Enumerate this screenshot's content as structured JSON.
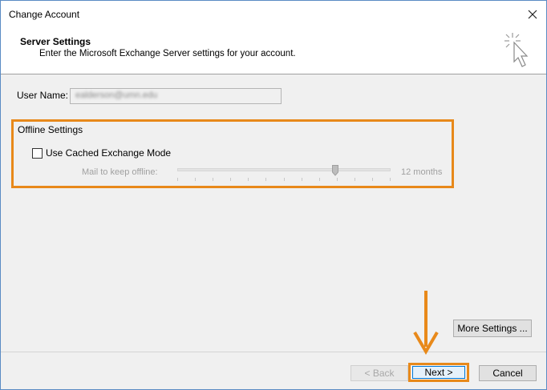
{
  "window": {
    "title": "Change Account"
  },
  "header": {
    "title": "Server Settings",
    "subtitle": "Enter the Microsoft Exchange Server settings for your account."
  },
  "form": {
    "username_label": "User Name:",
    "username_value": "ealderson@umn.edu"
  },
  "offline": {
    "group_label": "Offline Settings",
    "cached_mode_label": "Use Cached Exchange Mode",
    "cached_mode_checked": false,
    "keep_offline_label": "Mail to keep offline:",
    "keep_offline_value": "12 months",
    "slider_fraction": 0.74
  },
  "buttons": {
    "more_settings": "More Settings ...",
    "back": "< Back",
    "next": "Next >",
    "cancel": "Cancel"
  },
  "colors": {
    "highlight": "#e8891a",
    "accent": "#0078d7"
  },
  "icons": {
    "close": "close-icon",
    "header": "pointer-click-icon",
    "annotation": "down-arrow-icon"
  }
}
